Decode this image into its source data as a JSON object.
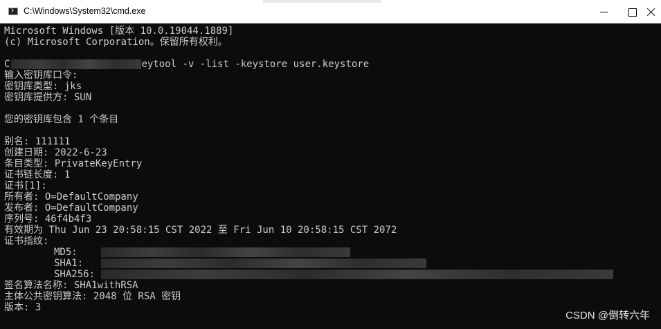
{
  "window": {
    "title": "C:\\Windows\\System32\\cmd.exe"
  },
  "console": {
    "header": [
      "Microsoft Windows [版本 10.0.19044.1889]",
      "(c) Microsoft Corporation。保留所有权利。"
    ],
    "prompt_prefix": "C",
    "command": "eytool -v -list -keystore user.keystore",
    "keystore_info": [
      "输入密钥库口令:",
      "密钥库类型: jks",
      "密钥库提供方: SUN"
    ],
    "entry_count": "您的密钥库包含 1 个条目",
    "entry": [
      "别名: 111111",
      "创建日期: 2022-6-23",
      "条目类型: PrivateKeyEntry",
      "证书链长度: 1",
      "证书[1]:",
      "所有者: O=DefaultCompany",
      "发布者: O=DefaultCompany",
      "序列号: 46f4b4f3",
      "有效期为 Thu Jun 23 20:58:15 CST 2022 至 Fri Jun 10 20:58:15 CST 2072",
      "证书指纹:"
    ],
    "fingerprints": {
      "md5": "MD5:",
      "sha1": "SHA1:",
      "sha256": "SHA256:"
    },
    "footer": [
      "签名算法名称: SHA1withRSA",
      "主体公共密钥算法: 2048 位 RSA 密钥",
      "版本: 3"
    ]
  },
  "watermark": "CSDN @倒转六年",
  "colors": {
    "console_bg": "#0c0c0c",
    "console_text": "#cccccc",
    "titlebar_bg": "#ffffff"
  }
}
